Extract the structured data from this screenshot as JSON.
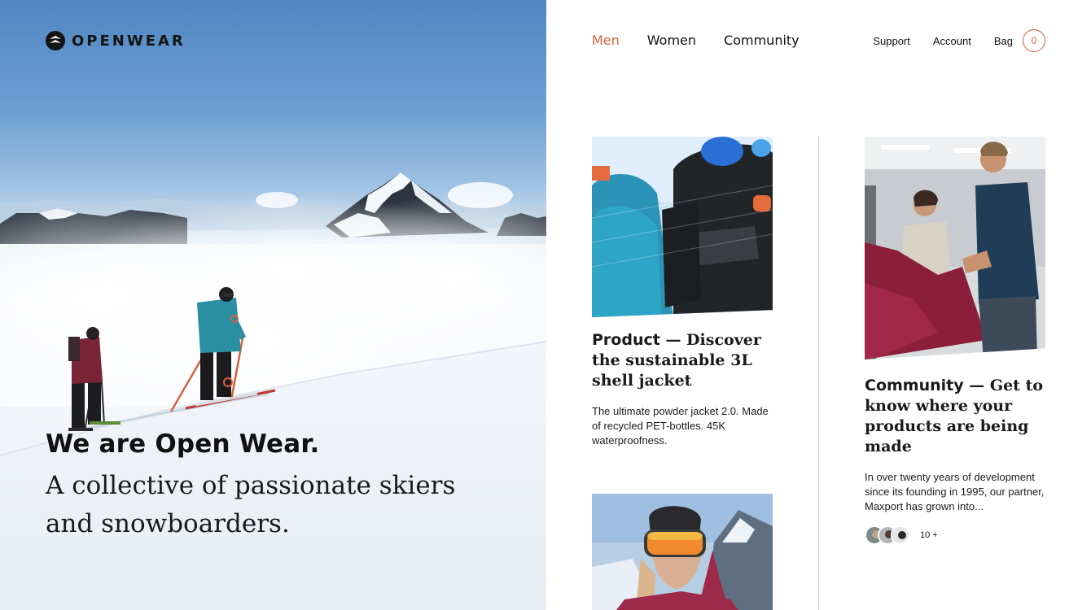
{
  "brand": {
    "name": "OPENWEAR",
    "logo_icon": "openwear-logo-icon"
  },
  "nav": {
    "primary": [
      {
        "label": "Men",
        "active": true
      },
      {
        "label": "Women",
        "active": false
      },
      {
        "label": "Community",
        "active": false
      }
    ],
    "secondary": {
      "support": "Support",
      "account": "Account",
      "bag": "Bag",
      "bag_count": "0"
    }
  },
  "hero": {
    "title": "We are Open Wear.",
    "subtitle": "A collective of passionate skiers and snowboarders."
  },
  "cards": {
    "product": {
      "strong": "Product",
      "heading": " — Discover the sustainable 3L shell jacket",
      "text": "The ultimate powder jacket 2.0. Made of recycled PET-bottles. 45K waterproofness."
    },
    "community": {
      "strong": "Community",
      "heading": " — Get to know where your products are being made",
      "text": "In over twenty years of development since its founding in 1995, our partner, Maxport has grown into...",
      "avatar_count": "10 +"
    }
  },
  "colors": {
    "accent": "#d4623c",
    "divider": "#e3cdb8",
    "text": "#111111"
  }
}
